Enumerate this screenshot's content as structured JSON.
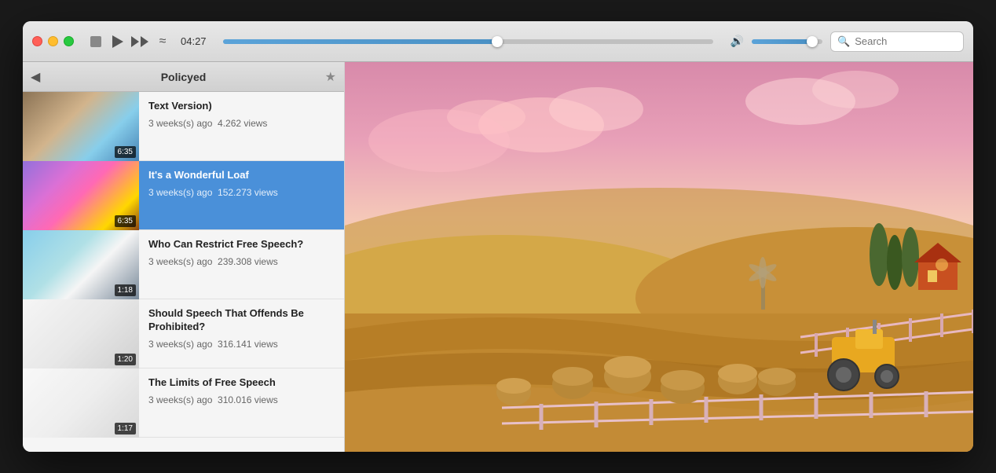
{
  "window": {
    "title": "Policyed",
    "traffic_lights": [
      "close",
      "minimize",
      "maximize"
    ]
  },
  "titlebar": {
    "time": "04:27",
    "progress_percent": 56,
    "volume_percent": 85,
    "search_placeholder": "Search"
  },
  "sidebar": {
    "title": "Policyed",
    "items": [
      {
        "id": 1,
        "title": "Text Version)",
        "meta_time": "3 weeks(s) ago",
        "meta_views": "4.262 views",
        "duration": "6:35",
        "thumb_class": "thumb-1",
        "active": false
      },
      {
        "id": 2,
        "title": "It's a Wonderful Loaf",
        "meta_time": "3 weeks(s) ago",
        "meta_views": "152.273 views",
        "duration": "6:35",
        "thumb_class": "thumb-2",
        "active": true
      },
      {
        "id": 3,
        "title": "Who Can Restrict Free Speech?",
        "meta_time": "3 weeks(s) ago",
        "meta_views": "239.308 views",
        "duration": "1:18",
        "thumb_class": "thumb-3",
        "active": false
      },
      {
        "id": 4,
        "title": "Should Speech That Offends Be Prohibited?",
        "meta_time": "3 weeks(s) ago",
        "meta_views": "316.141 views",
        "duration": "1:20",
        "thumb_class": "thumb-4",
        "active": false
      },
      {
        "id": 5,
        "title": "The Limits of Free Speech",
        "meta_time": "3 weeks(s) ago",
        "meta_views": "310.016 views",
        "duration": "1:17",
        "thumb_class": "thumb-5",
        "active": false
      }
    ]
  },
  "icons": {
    "back": "◀",
    "star": "★",
    "play": "▶",
    "stop": "■",
    "ff": "▶▶",
    "wavy": "≈",
    "volume": "🔊",
    "search": "🔍"
  }
}
